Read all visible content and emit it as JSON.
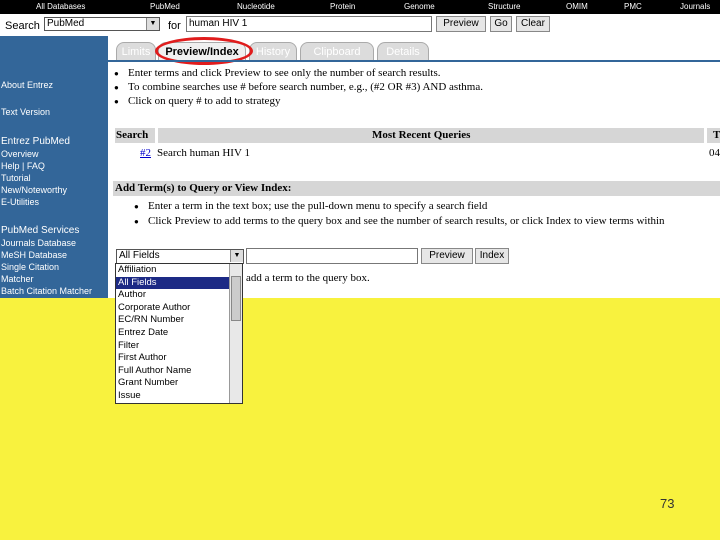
{
  "top_nav": [
    "All Databases",
    "PubMed",
    "Nucleotide",
    "Protein",
    "Genome",
    "Structure",
    "OMIM",
    "PMC",
    "Journals"
  ],
  "search": {
    "label": "Search",
    "database": "PubMed",
    "for_label": "for",
    "query": "human HIV 1",
    "preview_button": "Preview",
    "go_button": "Go",
    "clear_button": "Clear"
  },
  "tabs": [
    "Limits",
    "Preview/Index",
    "History",
    "Clipboard",
    "Details"
  ],
  "sidebar": {
    "about_entrez": "About Entrez",
    "text_version": "Text Version",
    "entrez_pubmed_header": "Entrez PubMed",
    "entrez_pubmed_items": [
      "Overview",
      "Help | FAQ",
      "Tutorial",
      "New/Noteworthy",
      "E-Utilities"
    ],
    "pubmed_services_header": "PubMed Services",
    "pubmed_services_items": [
      "Journals Database",
      "MeSH Database",
      "Single Citation",
      "Matcher",
      "Batch Citation Matcher"
    ]
  },
  "instructions": [
    "Enter terms and click Preview to see only the number of search results.",
    "To combine searches use # before search number, e.g., (#2 OR #3) AND asthma.",
    "Click on query # to add to strategy"
  ],
  "queries_table": {
    "col_search": "Search",
    "col_title": "Most Recent Queries",
    "col_time": "T",
    "row_num": "#2",
    "row_query": "Search human HIV 1",
    "row_time": "04"
  },
  "add_terms": {
    "header": "Add Term(s) to Query or View Index:",
    "bullets": [
      "Enter a term in the text box; use the pull-down menu to specify a search field",
      "Click Preview to add terms to the query box and see the number of search results, or click Index to view terms within"
    ],
    "field_select": "All Fields",
    "preview_button": "Preview",
    "index_button": "Index",
    "trailing_text": "add a term to the query box."
  },
  "field_options": [
    "Affiliation",
    "All Fields",
    "Author",
    "Corporate Author",
    "EC/RN Number",
    "Entrez Date",
    "Filter",
    "First Author",
    "Full Author Name",
    "Grant Number",
    "Issue"
  ],
  "selected_field_index": 1,
  "page_number": "73",
  "colors": {
    "sidebar": "#336699",
    "background_yellow": "#f8f23e",
    "highlight_circle": "#e01c1c",
    "selected_option": "#1c2a85"
  }
}
